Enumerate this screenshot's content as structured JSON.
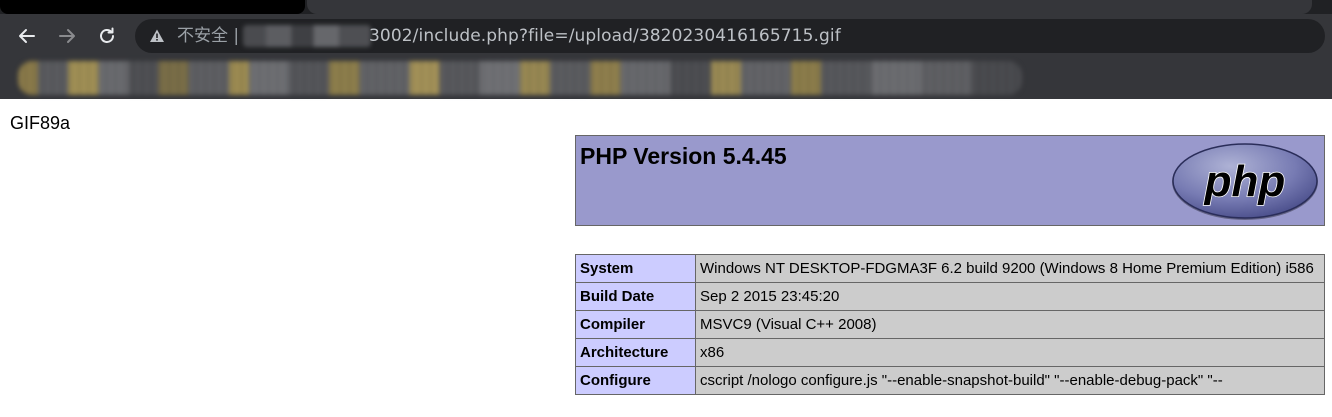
{
  "browser": {
    "address_bar": {
      "security_label": "不安全 |",
      "url_visible": "3002/include.php?file=/upload/3820230416165715.gif"
    }
  },
  "page": {
    "gif_header": "GIF89a",
    "phpinfo": {
      "title": "PHP Version 5.4.45",
      "logo_text": "php",
      "rows": [
        {
          "key": "System",
          "value": "Windows NT DESKTOP-FDGMA3F 6.2 build 9200 (Windows 8 Home Premium Edition) i586"
        },
        {
          "key": "Build Date",
          "value": "Sep 2 2015 23:45:20"
        },
        {
          "key": "Compiler",
          "value": "MSVC9 (Visual C++ 2008)"
        },
        {
          "key": "Architecture",
          "value": "x86"
        },
        {
          "key": "Configure",
          "value": "cscript /nologo configure.js \"--enable-snapshot-build\" \"--enable-debug-pack\" \"--"
        }
      ]
    }
  },
  "colors": {
    "chrome_bg": "#35363a",
    "omnibox_bg": "#202124",
    "php_header_bg": "#9999cc",
    "php_key_bg": "#ccccff",
    "php_value_bg": "#cccccc"
  }
}
